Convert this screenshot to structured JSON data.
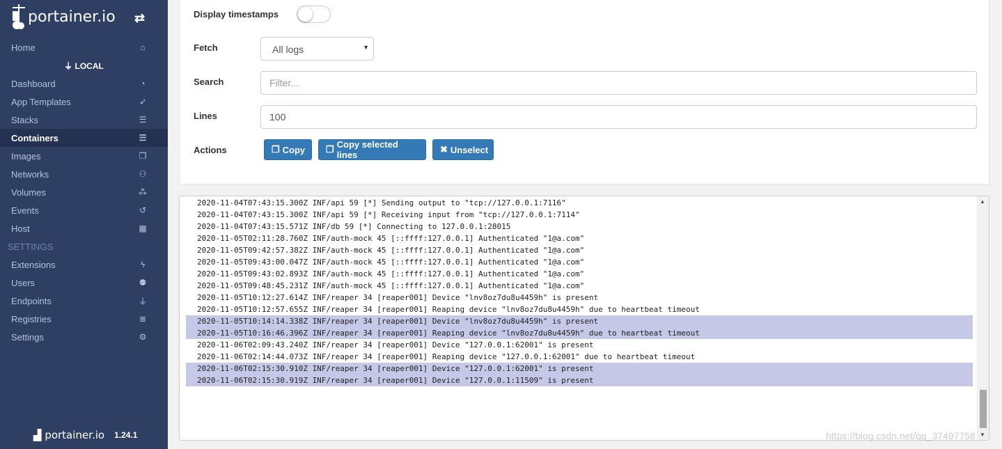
{
  "sidebar": {
    "brand": "portainer.io",
    "home": "Home",
    "endpoint": "LOCAL",
    "items": [
      {
        "label": "Dashboard",
        "icon": "tachometer-icon",
        "glyph": "◔"
      },
      {
        "label": "App Templates",
        "icon": "rocket-icon",
        "glyph": "➶"
      },
      {
        "label": "Stacks",
        "icon": "th-list-icon",
        "glyph": "☰"
      },
      {
        "label": "Containers",
        "icon": "server-icon",
        "glyph": "☰",
        "active": true
      },
      {
        "label": "Images",
        "icon": "clone-icon",
        "glyph": "❐"
      },
      {
        "label": "Networks",
        "icon": "sitemap-icon",
        "glyph": "⚇"
      },
      {
        "label": "Volumes",
        "icon": "cubes-icon",
        "glyph": "⁂"
      },
      {
        "label": "Events",
        "icon": "history-icon",
        "glyph": "↺"
      },
      {
        "label": "Host",
        "icon": "th-icon",
        "glyph": "▦"
      }
    ],
    "settings_header": "SETTINGS",
    "settings_items": [
      {
        "label": "Extensions",
        "icon": "bolt-icon",
        "glyph": "ϟ"
      },
      {
        "label": "Users",
        "icon": "users-icon",
        "glyph": "⚉"
      },
      {
        "label": "Endpoints",
        "icon": "plug-icon",
        "glyph": "⏚"
      },
      {
        "label": "Registries",
        "icon": "database-icon",
        "glyph": "≣"
      },
      {
        "label": "Settings",
        "icon": "cogs-icon",
        "glyph": "⚙"
      }
    ],
    "footer_brand": "portainer.io",
    "version": "1.24.1"
  },
  "form": {
    "timestamps_label": "Display timestamps",
    "timestamps_on": false,
    "fetch_label": "Fetch",
    "fetch_value": "All logs",
    "search_label": "Search",
    "search_placeholder": "Filter...",
    "lines_label": "Lines",
    "lines_value": "100",
    "actions_label": "Actions",
    "copy": "Copy",
    "copy_selected": "Copy selected lines",
    "unselect": "Unselect"
  },
  "logs": [
    {
      "text": "2020-11-04T07:43:15.300Z INF/api 59 [*] Sending output to \"tcp://127.0.0.1:7116\"",
      "selected": false
    },
    {
      "text": "2020-11-04T07:43:15.300Z INF/api 59 [*] Receiving input from \"tcp://127.0.0.1:7114\"",
      "selected": false
    },
    {
      "text": "2020-11-04T07:43:15.571Z INF/db 59 [*] Connecting to 127.0.0.1:28015",
      "selected": false
    },
    {
      "text": "2020-11-05T02:11:28.760Z INF/auth-mock 45 [::ffff:127.0.0.1] Authenticated \"1@a.com\"",
      "selected": false
    },
    {
      "text": "2020-11-05T09:42:57.382Z INF/auth-mock 45 [::ffff:127.0.0.1] Authenticated \"1@a.com\"",
      "selected": false
    },
    {
      "text": "2020-11-05T09:43:00.047Z INF/auth-mock 45 [::ffff:127.0.0.1] Authenticated \"1@a.com\"",
      "selected": false
    },
    {
      "text": "2020-11-05T09:43:02.893Z INF/auth-mock 45 [::ffff:127.0.0.1] Authenticated \"1@a.com\"",
      "selected": false
    },
    {
      "text": "2020-11-05T09:48:45.231Z INF/auth-mock 45 [::ffff:127.0.0.1] Authenticated \"1@a.com\"",
      "selected": false
    },
    {
      "text": "2020-11-05T10:12:27.614Z INF/reaper 34 [reaper001] Device \"lnv8oz7du8u4459h\" is present",
      "selected": false
    },
    {
      "text": "2020-11-05T10:12:57.655Z INF/reaper 34 [reaper001] Reaping device \"lnv8oz7du8u4459h\" due to heartbeat timeout",
      "selected": false
    },
    {
      "text": "2020-11-05T10:14:14.338Z INF/reaper 34 [reaper001] Device \"lnv8oz7du8u4459h\" is present",
      "selected": true
    },
    {
      "text": "2020-11-05T10:16:46.396Z INF/reaper 34 [reaper001] Reaping device \"lnv8oz7du8u4459h\" due to heartbeat timeout",
      "selected": true
    },
    {
      "text": "2020-11-06T02:09:43.240Z INF/reaper 34 [reaper001] Device \"127.0.0.1:62001\" is present",
      "selected": false
    },
    {
      "text": "2020-11-06T02:14:44.073Z INF/reaper 34 [reaper001] Reaping device \"127.0.0.1:62001\" due to heartbeat timeout",
      "selected": false
    },
    {
      "text": "2020-11-06T02:15:30.910Z INF/reaper 34 [reaper001] Device \"127.0.0.1:62001\" is present",
      "selected": true
    },
    {
      "text": "2020-11-06T02:15:30.919Z INF/reaper 34 [reaper001] Device \"127.0.0.1:11509\" is present",
      "selected": true
    }
  ],
  "watermark": "https://blog.csdn.net/qq_37497758"
}
